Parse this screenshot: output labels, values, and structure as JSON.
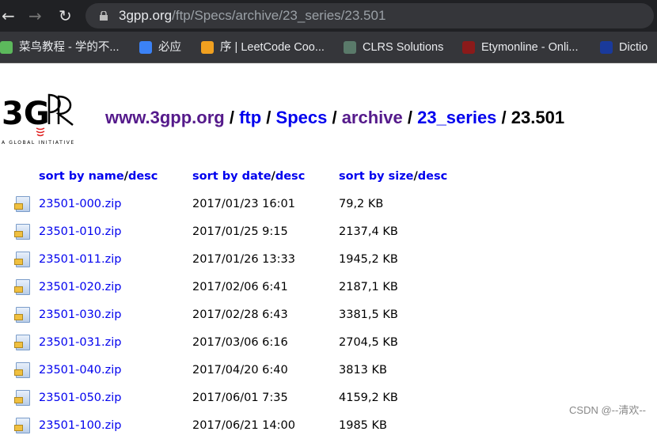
{
  "browser": {
    "url_host": "3gpp.org",
    "url_path": "/ftp/Specs/archive/23_series/23.501",
    "bookmarks": [
      {
        "label": "菜鸟教程 - 学的不...",
        "icon": "runoob-icon",
        "color": "#5cb85c"
      },
      {
        "label": "必应",
        "icon": "bing-search-icon",
        "color": "#3b82f6"
      },
      {
        "label": "序 | LeetCode Coo...",
        "icon": "leetcode-icon",
        "color": "#f0a020"
      },
      {
        "label": "CLRS Solutions",
        "icon": "clrs-icon",
        "color": "#5a7a6a"
      },
      {
        "label": "Etymonline - Onli...",
        "icon": "etymonline-icon",
        "color": "#8b1a1a"
      },
      {
        "label": "Dictio",
        "icon": "dictionary-icon",
        "color": "#1a3a9b"
      }
    ]
  },
  "logo": {
    "text": "3GPP",
    "tagline": "A GLOBAL INITIATIVE"
  },
  "breadcrumb": [
    {
      "label": "www.3gpp.org",
      "visited": true
    },
    {
      "label": "ftp",
      "visited": false
    },
    {
      "label": "Specs",
      "visited": false
    },
    {
      "label": "archive",
      "visited": true
    },
    {
      "label": "23_series",
      "visited": false
    }
  ],
  "breadcrumb_sep": " / ",
  "current": "23.501",
  "headers": {
    "name": "sort by name",
    "date": "sort by date",
    "size": "sort by size",
    "desc": "desc",
    "slash": "/"
  },
  "files": [
    {
      "name": "23501-000.zip",
      "date": "2017/01/23 16:01",
      "size": "79,2 KB"
    },
    {
      "name": "23501-010.zip",
      "date": "2017/01/25 9:15",
      "size": "2137,4 KB"
    },
    {
      "name": "23501-011.zip",
      "date": "2017/01/26 13:33",
      "size": "1945,2 KB"
    },
    {
      "name": "23501-020.zip",
      "date": "2017/02/06 6:41",
      "size": "2187,1 KB"
    },
    {
      "name": "23501-030.zip",
      "date": "2017/02/28 6:43",
      "size": "3381,5 KB"
    },
    {
      "name": "23501-031.zip",
      "date": "2017/03/06 6:16",
      "size": "2704,5 KB"
    },
    {
      "name": "23501-040.zip",
      "date": "2017/04/20 6:40",
      "size": "3813 KB"
    },
    {
      "name": "23501-050.zip",
      "date": "2017/06/01 7:35",
      "size": "4159,2 KB"
    },
    {
      "name": "23501-100.zip",
      "date": "2017/06/21 14:00",
      "size": "1985 KB"
    }
  ],
  "watermark": "CSDN @--清欢--"
}
